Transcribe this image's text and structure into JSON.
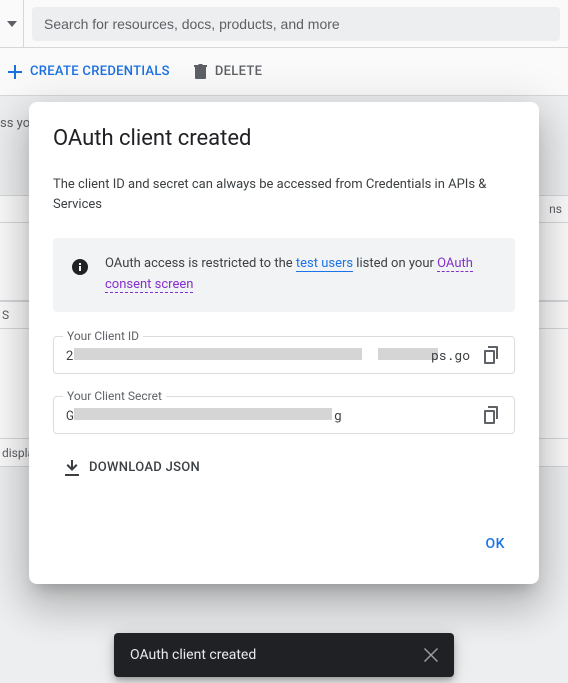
{
  "search": {
    "placeholder": "Search for resources, docs, products, and more"
  },
  "actionbar": {
    "create_label": "CREATE CREDENTIALS",
    "delete_label": "DELETE"
  },
  "background": {
    "line1_fragment": "ss you",
    "col_right_fragment": "ns",
    "row_left_fragment": "S",
    "bottom_fragment": "displa"
  },
  "dialog": {
    "title": "OAuth client created",
    "desc": "The client ID and secret can always be accessed from Credentials in APIs & Services",
    "info_pre": "OAuth access is restricted to the ",
    "info_link1": "test users",
    "info_mid": " listed on your ",
    "info_link2": "OAuth consent screen",
    "client_id_label": "Your Client ID",
    "client_id_prefix": "2",
    "client_id_suffix": "ps.go",
    "client_secret_label": "Your Client Secret",
    "client_secret_prefix": "G",
    "client_secret_suffix": "g",
    "download_label": "DOWNLOAD JSON",
    "ok_label": "OK"
  },
  "toast": {
    "message": "OAuth client created"
  }
}
